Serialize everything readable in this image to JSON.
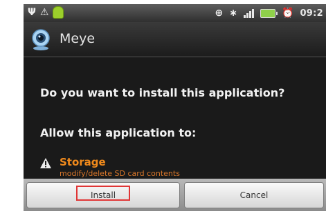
{
  "status_bar": {
    "time": "09:2",
    "icons": [
      "usb-icon",
      "warning-icon",
      "android-icon",
      "gps-icon",
      "bluetooth-icon",
      "signal-icon",
      "battery-icon",
      "alarm-icon"
    ]
  },
  "title_bar": {
    "app_name": "Meye",
    "app_icon": "webcam-icon"
  },
  "dialog": {
    "question": "Do you want to install this application?",
    "allow_label": "Allow this application to:",
    "permission": {
      "title": "Storage",
      "description": "modify/delete SD card contents",
      "icon": "warning-triangle-icon"
    }
  },
  "buttons": {
    "install": "Install",
    "cancel": "Cancel"
  },
  "colors": {
    "permission_title": "#f08a1c",
    "permission_desc": "#d9772a",
    "highlight_box": "#e03535"
  }
}
